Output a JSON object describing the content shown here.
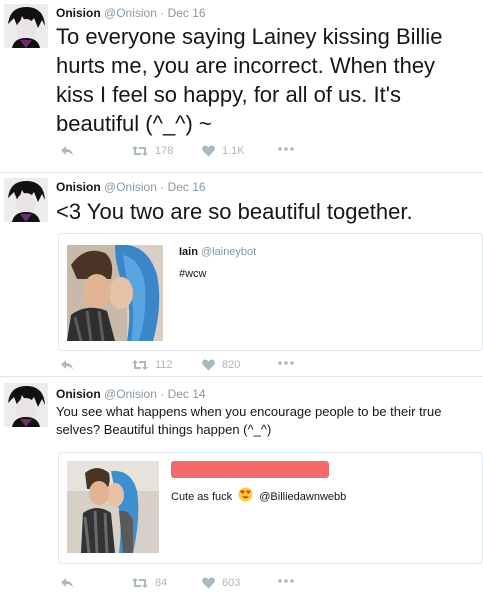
{
  "colors": {
    "text": "#14171a",
    "muted": "#8899a6",
    "action": "#aab8c2",
    "divider": "#e1e8ed",
    "redaction": "#f56a6a"
  },
  "tweets": [
    {
      "name": "Onision",
      "handle": "@Onision",
      "separator": "·",
      "date": "Dec 16",
      "text_lines": [
        "To everyone saying Lainey kissing Billie",
        "hurts me, you are incorrect. When they",
        "kiss I feel so happy, for all of us. It's",
        "beautiful (^_^) ~"
      ],
      "retweets": "178",
      "likes": "1.1K",
      "reply_icon": "reply-icon",
      "retweet_icon": "retweet-icon",
      "like_icon": "heart-icon",
      "more_icon": "more-icon"
    },
    {
      "name": "Onision",
      "handle": "@Onision",
      "separator": "·",
      "date": "Dec 16",
      "text_lines": [
        "<3 You two are so beautiful together."
      ],
      "retweets": "112",
      "likes": "820",
      "quote": {
        "name": "Iain",
        "handle": "@laineybot",
        "text": "#wcw"
      }
    },
    {
      "name": "Onision",
      "handle": "@Onision",
      "separator": "·",
      "date": "Dec 14",
      "text_lines": [
        "You see what happens when you encourage people to be their true",
        "selves? Beautiful things happen (^_^)"
      ],
      "retweets": "84",
      "likes": "603",
      "quote": {
        "text_before": "Cute as fuck",
        "emoji": "heart-eyes-emoji",
        "mention": "@Billiedawnwebb"
      }
    }
  ]
}
